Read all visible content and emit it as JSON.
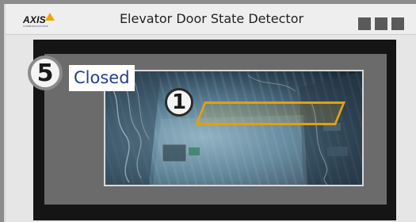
{
  "window": {
    "logo_text": "AXIS",
    "logo_subtext": "COMMUNICATIONS",
    "title": "Elevator Door State Detector"
  },
  "window_controls": [
    "minimize",
    "maximize",
    "close"
  ],
  "status": {
    "marker": "5",
    "label": "Closed"
  },
  "camera_view": {
    "region_marker": "1",
    "region_color": "#e0a012"
  },
  "colors": {
    "label_text": "#1f3f90",
    "logo_accent": "#f2a400"
  }
}
